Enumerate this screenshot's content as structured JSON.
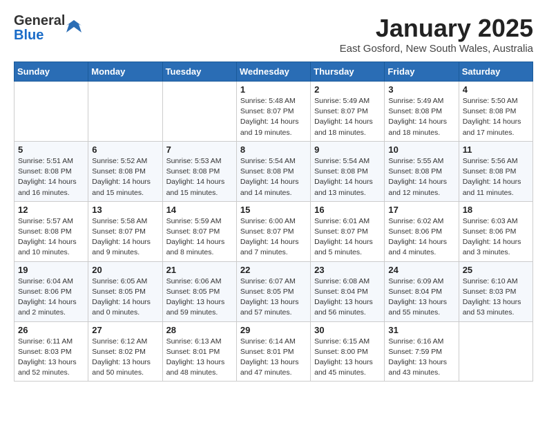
{
  "header": {
    "logo_general": "General",
    "logo_blue": "Blue",
    "month": "January 2025",
    "location": "East Gosford, New South Wales, Australia"
  },
  "days_of_week": [
    "Sunday",
    "Monday",
    "Tuesday",
    "Wednesday",
    "Thursday",
    "Friday",
    "Saturday"
  ],
  "weeks": [
    [
      {
        "day": "",
        "content": ""
      },
      {
        "day": "",
        "content": ""
      },
      {
        "day": "",
        "content": ""
      },
      {
        "day": "1",
        "content": "Sunrise: 5:48 AM\nSunset: 8:07 PM\nDaylight: 14 hours\nand 19 minutes."
      },
      {
        "day": "2",
        "content": "Sunrise: 5:49 AM\nSunset: 8:07 PM\nDaylight: 14 hours\nand 18 minutes."
      },
      {
        "day": "3",
        "content": "Sunrise: 5:49 AM\nSunset: 8:08 PM\nDaylight: 14 hours\nand 18 minutes."
      },
      {
        "day": "4",
        "content": "Sunrise: 5:50 AM\nSunset: 8:08 PM\nDaylight: 14 hours\nand 17 minutes."
      }
    ],
    [
      {
        "day": "5",
        "content": "Sunrise: 5:51 AM\nSunset: 8:08 PM\nDaylight: 14 hours\nand 16 minutes."
      },
      {
        "day": "6",
        "content": "Sunrise: 5:52 AM\nSunset: 8:08 PM\nDaylight: 14 hours\nand 15 minutes."
      },
      {
        "day": "7",
        "content": "Sunrise: 5:53 AM\nSunset: 8:08 PM\nDaylight: 14 hours\nand 15 minutes."
      },
      {
        "day": "8",
        "content": "Sunrise: 5:54 AM\nSunset: 8:08 PM\nDaylight: 14 hours\nand 14 minutes."
      },
      {
        "day": "9",
        "content": "Sunrise: 5:54 AM\nSunset: 8:08 PM\nDaylight: 14 hours\nand 13 minutes."
      },
      {
        "day": "10",
        "content": "Sunrise: 5:55 AM\nSunset: 8:08 PM\nDaylight: 14 hours\nand 12 minutes."
      },
      {
        "day": "11",
        "content": "Sunrise: 5:56 AM\nSunset: 8:08 PM\nDaylight: 14 hours\nand 11 minutes."
      }
    ],
    [
      {
        "day": "12",
        "content": "Sunrise: 5:57 AM\nSunset: 8:08 PM\nDaylight: 14 hours\nand 10 minutes."
      },
      {
        "day": "13",
        "content": "Sunrise: 5:58 AM\nSunset: 8:07 PM\nDaylight: 14 hours\nand 9 minutes."
      },
      {
        "day": "14",
        "content": "Sunrise: 5:59 AM\nSunset: 8:07 PM\nDaylight: 14 hours\nand 8 minutes."
      },
      {
        "day": "15",
        "content": "Sunrise: 6:00 AM\nSunset: 8:07 PM\nDaylight: 14 hours\nand 7 minutes."
      },
      {
        "day": "16",
        "content": "Sunrise: 6:01 AM\nSunset: 8:07 PM\nDaylight: 14 hours\nand 5 minutes."
      },
      {
        "day": "17",
        "content": "Sunrise: 6:02 AM\nSunset: 8:06 PM\nDaylight: 14 hours\nand 4 minutes."
      },
      {
        "day": "18",
        "content": "Sunrise: 6:03 AM\nSunset: 8:06 PM\nDaylight: 14 hours\nand 3 minutes."
      }
    ],
    [
      {
        "day": "19",
        "content": "Sunrise: 6:04 AM\nSunset: 8:06 PM\nDaylight: 14 hours\nand 2 minutes."
      },
      {
        "day": "20",
        "content": "Sunrise: 6:05 AM\nSunset: 8:05 PM\nDaylight: 14 hours\nand 0 minutes."
      },
      {
        "day": "21",
        "content": "Sunrise: 6:06 AM\nSunset: 8:05 PM\nDaylight: 13 hours\nand 59 minutes."
      },
      {
        "day": "22",
        "content": "Sunrise: 6:07 AM\nSunset: 8:05 PM\nDaylight: 13 hours\nand 57 minutes."
      },
      {
        "day": "23",
        "content": "Sunrise: 6:08 AM\nSunset: 8:04 PM\nDaylight: 13 hours\nand 56 minutes."
      },
      {
        "day": "24",
        "content": "Sunrise: 6:09 AM\nSunset: 8:04 PM\nDaylight: 13 hours\nand 55 minutes."
      },
      {
        "day": "25",
        "content": "Sunrise: 6:10 AM\nSunset: 8:03 PM\nDaylight: 13 hours\nand 53 minutes."
      }
    ],
    [
      {
        "day": "26",
        "content": "Sunrise: 6:11 AM\nSunset: 8:03 PM\nDaylight: 13 hours\nand 52 minutes."
      },
      {
        "day": "27",
        "content": "Sunrise: 6:12 AM\nSunset: 8:02 PM\nDaylight: 13 hours\nand 50 minutes."
      },
      {
        "day": "28",
        "content": "Sunrise: 6:13 AM\nSunset: 8:01 PM\nDaylight: 13 hours\nand 48 minutes."
      },
      {
        "day": "29",
        "content": "Sunrise: 6:14 AM\nSunset: 8:01 PM\nDaylight: 13 hours\nand 47 minutes."
      },
      {
        "day": "30",
        "content": "Sunrise: 6:15 AM\nSunset: 8:00 PM\nDaylight: 13 hours\nand 45 minutes."
      },
      {
        "day": "31",
        "content": "Sunrise: 6:16 AM\nSunset: 7:59 PM\nDaylight: 13 hours\nand 43 minutes."
      },
      {
        "day": "",
        "content": ""
      }
    ]
  ]
}
